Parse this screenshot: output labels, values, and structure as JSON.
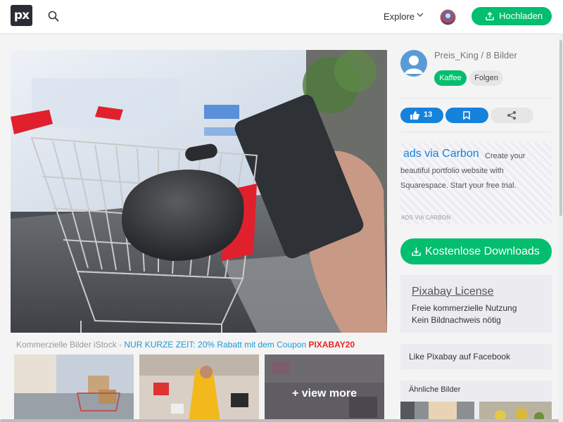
{
  "header": {
    "logo_text": "px",
    "explore_label": "Explore",
    "upload_label": "Hochladen"
  },
  "promo": {
    "prefix": "Kommerzielle Bilder iStock - ",
    "accent": "NUR KURZE ZEIT: 20% Rabatt mit dem Coupon ",
    "coupon": "PIXABAY20"
  },
  "thumbnails": {
    "view_more_label": "+ view more"
  },
  "author": {
    "name_line": "Preis_King / 8 Bilder",
    "coffee_label": "Kaffee",
    "follow_label": "Folgen"
  },
  "actions": {
    "like_count": "13"
  },
  "carbon_ad": {
    "title": "ads via Carbon",
    "text": "Create your beautiful portfolio website with Squarespace. Start your free trial.",
    "byline": "ADS VIA CARBON"
  },
  "download": {
    "label": "Kostenlose Downloads"
  },
  "license": {
    "title": "Pixabay License",
    "line1": "Freie kommerzielle Nutzung",
    "line2": "Kein Bildnachweis nötig"
  },
  "facebook": {
    "label": "Like Pixabay auf Facebook"
  },
  "similar": {
    "title": "Ähnliche Bilder"
  },
  "colors": {
    "brand_green": "#02be6e",
    "action_blue": "#1582db",
    "coupon_red": "#ee2222",
    "link_blue": "#1a9bd7"
  }
}
